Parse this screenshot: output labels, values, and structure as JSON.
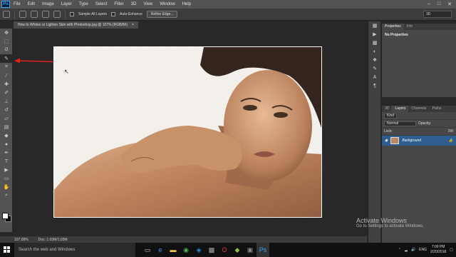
{
  "app": {
    "logo": "Ps"
  },
  "menu": [
    "File",
    "Edit",
    "Image",
    "Layer",
    "Type",
    "Select",
    "Filter",
    "3D",
    "View",
    "Window",
    "Help"
  ],
  "window_controls": [
    "–",
    "□",
    "✕"
  ],
  "options": {
    "sample_all_layers": "Sample All Layers",
    "auto_enhance": "Auto-Enhance",
    "refine_edge": "Refine Edge...",
    "workspace": "3D"
  },
  "document": {
    "tab_title": "How to Whiten or Lighten Skin with Photoshop.jpg @ 107% (RGB/8#)",
    "close_icon": "×"
  },
  "status": {
    "zoom": "107.09%",
    "doc_size": "Doc: 1.03M/1.03M"
  },
  "properties": {
    "tabs": [
      "Properties",
      "Info"
    ],
    "body": "No Properties"
  },
  "layers": {
    "tabs": [
      "3D",
      "Layers",
      "Channels",
      "Paths"
    ],
    "kind": "Kind",
    "blend_mode": "Normal",
    "opacity_label": "Opacity:",
    "lock_label": "Lock:",
    "fill_label": "Fill:",
    "background_layer": "Background"
  },
  "activate": {
    "title": "Activate Windows",
    "subtitle": "Go to Settings to activate Windows."
  },
  "taskbar": {
    "search_placeholder": "Search the web and Windows",
    "language": "ENG",
    "time": "7:09 PM",
    "date": "2/20/2018"
  },
  "colors": {
    "accent_tab": "#31a8ff",
    "arrow": "#e02020",
    "selected_layer": "#2d5e8f"
  }
}
